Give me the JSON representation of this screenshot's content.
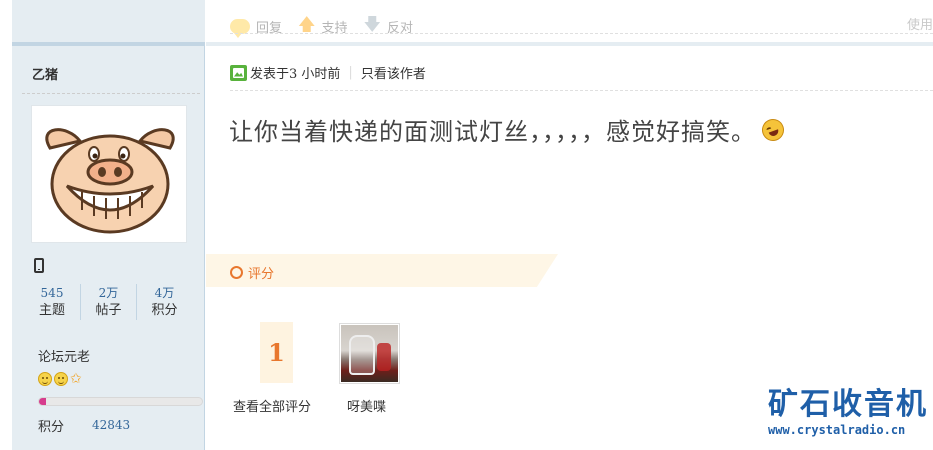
{
  "actions": {
    "reply": "回复",
    "support": "支持",
    "oppose": "反对",
    "use": "使用"
  },
  "author": {
    "name": "乙猪",
    "stats": [
      {
        "value": "545",
        "label": "主题"
      },
      {
        "value": "2万",
        "label": "帖子"
      },
      {
        "value": "4万",
        "label": "积分"
      }
    ],
    "rank": "论坛元老",
    "progress_fraction": 0.04,
    "credit_label": "积分",
    "credit_value": "42843"
  },
  "post": {
    "meta_posted": "发表于",
    "meta_time": "3 小时前",
    "meta_only_author": "只看该作者",
    "body": "让你当着快递的面测试灯丝，，，，，感觉好搞笑。"
  },
  "rating": {
    "label": "评分",
    "count": "1",
    "view_all": "查看全部评分",
    "rater_name": "呀美喋"
  },
  "watermark": {
    "title": "矿石收音机",
    "url": "www.crystalradio.cn"
  },
  "colors": {
    "sidebar_bg": "#e5edf2",
    "link_blue": "#336699",
    "rate_orange": "#e8772e",
    "brand_blue": "#1f5fa8"
  }
}
